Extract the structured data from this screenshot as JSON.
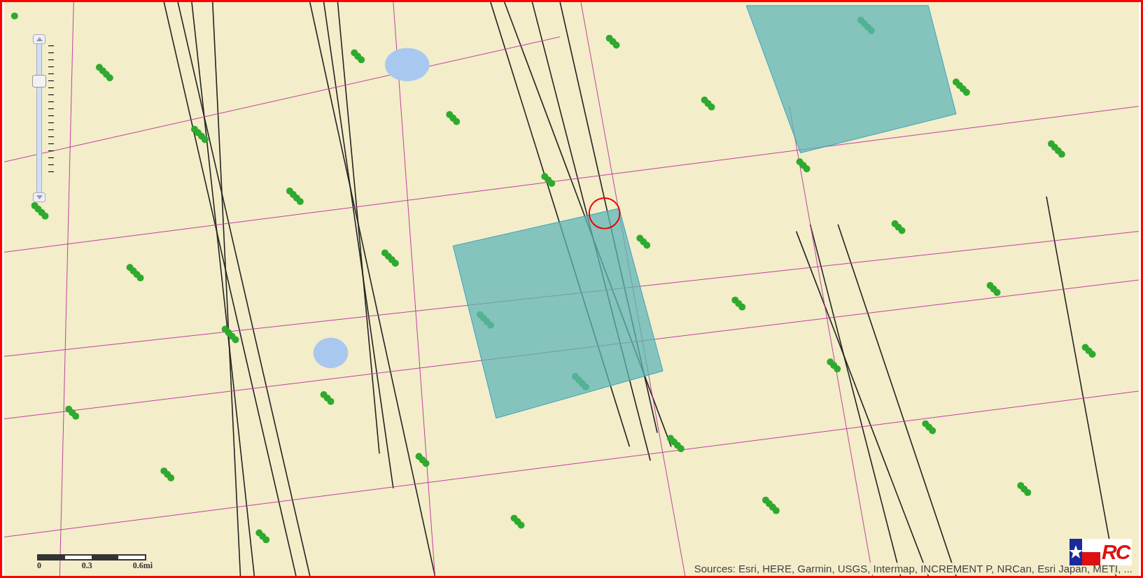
{
  "zoom_slider": {
    "level": 0.75
  },
  "scale_bar": {
    "labels": [
      "0",
      "0.3",
      "0.6mi"
    ]
  },
  "attribution": "Sources: Esri, HERE, Garmin, USGS, Intermap, INCREMENT P, NRCan, Esri Japan, METI, ...",
  "logo": {
    "text": "RC"
  }
}
